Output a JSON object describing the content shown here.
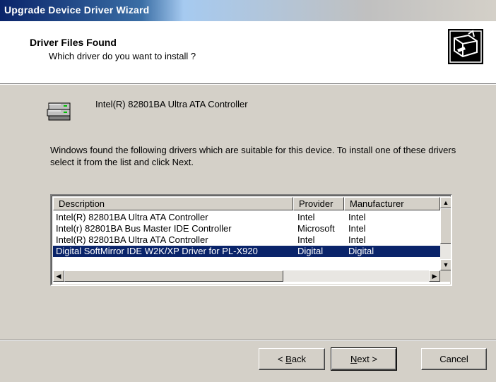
{
  "window": {
    "title": "Upgrade Device Driver Wizard"
  },
  "header": {
    "title": "Driver Files Found",
    "subtitle": "Which driver do you want to install ?",
    "icon": "hardware-wizard-icon"
  },
  "device": {
    "icon": "disk-controller-icon",
    "name": "Intel(R) 82801BA Ultra ATA Controller"
  },
  "instructions": "Windows found the following drivers which are suitable for this device. To install one of these drivers select it from the list and click Next.",
  "driver_list": {
    "columns": [
      "Description",
      "Provider",
      "Manufacturer"
    ],
    "rows": [
      {
        "description": "Intel(R) 82801BA Ultra ATA Controller",
        "provider": "Intel",
        "manufacturer": "Intel"
      },
      {
        "description": "Intel(r) 82801BA Bus Master IDE Controller",
        "provider": "Microsoft",
        "manufacturer": "Intel"
      },
      {
        "description": "Intel(R) 82801BA Ultra ATA Controller",
        "provider": "Intel",
        "manufacturer": "Intel"
      },
      {
        "description": "Digital SoftMirror IDE W2K/XP Driver for PL-X920",
        "provider": "Digital",
        "manufacturer": "Digital"
      }
    ],
    "selected_index": 3
  },
  "buttons": {
    "back_key": "B",
    "back_rest": "ack",
    "back_prefix": "< ",
    "next_key": "N",
    "next_rest": "ext >",
    "cancel": "Cancel"
  },
  "colors": {
    "selection": "#0a246a",
    "titlebar": "#0a246a",
    "face": "#d4d0c8"
  }
}
